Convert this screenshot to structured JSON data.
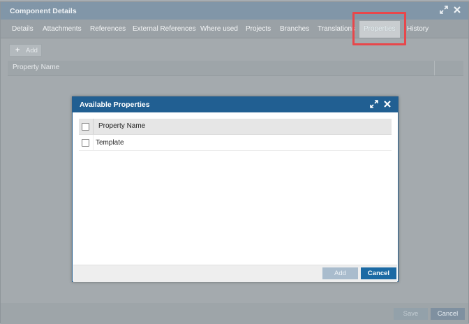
{
  "outer_dialog": {
    "title": "Component Details",
    "tabs": [
      {
        "label": "Details"
      },
      {
        "label": "Attachments"
      },
      {
        "label": "References"
      },
      {
        "label": "External References"
      },
      {
        "label": "Where used"
      },
      {
        "label": "Projects"
      },
      {
        "label": "Branches"
      },
      {
        "label": "Translations"
      },
      {
        "label": "Properties",
        "active": true
      },
      {
        "label": "History"
      }
    ],
    "toolbar": {
      "add_label": "Add",
      "add_icon": "plus-icon"
    },
    "grid": {
      "columns": [
        "Property Name"
      ]
    },
    "footer": {
      "save_label": "Save",
      "cancel_label": "Cancel"
    }
  },
  "modal": {
    "title": "Available Properties",
    "grid": {
      "columns": [
        "Property Name"
      ],
      "rows": [
        {
          "property_name": "Template"
        }
      ]
    },
    "footer": {
      "add_label": "Add",
      "cancel_label": "Cancel"
    }
  },
  "colors": {
    "modal_title_bg": "#215f92",
    "primary_button": "#1c6aa4",
    "highlight_border": "#e8474b"
  }
}
